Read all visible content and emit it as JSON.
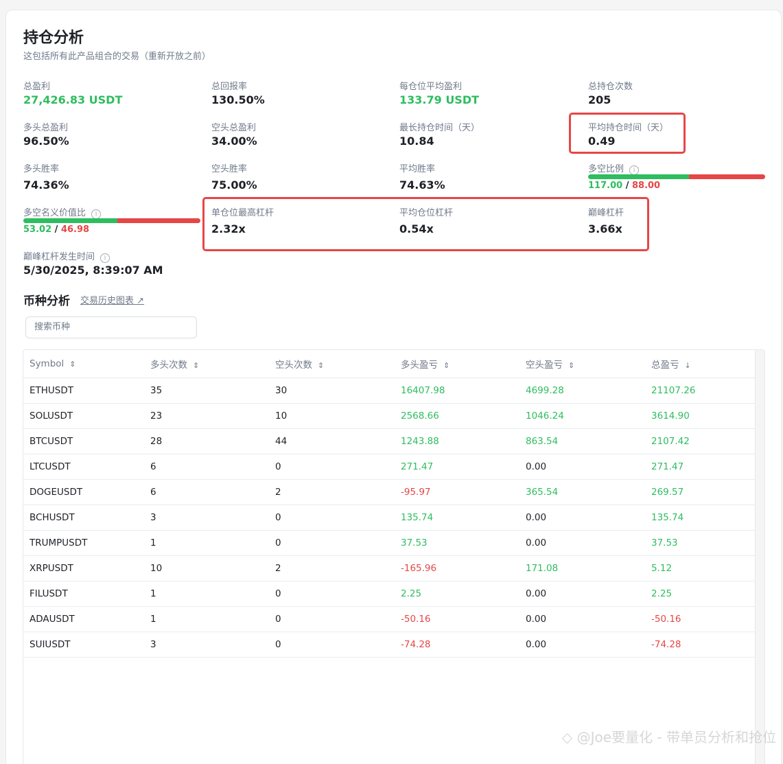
{
  "header": {
    "title": "持仓分析",
    "subtitle": "这包括所有此产品组合的交易（重新开放之前）"
  },
  "stats": {
    "total_pnl": {
      "label": "总盈利",
      "value": "27,426.83 USDT"
    },
    "total_return": {
      "label": "总回报率",
      "value": "130.50%"
    },
    "avg_pnl_per_position": {
      "label": "每仓位平均盈利",
      "value": "133.79 USDT"
    },
    "total_positions": {
      "label": "总持仓次数",
      "value": "205"
    },
    "long_total_pnl": {
      "label": "多头总盈利",
      "value": "96.50%"
    },
    "short_total_pnl": {
      "label": "空头总盈利",
      "value": "34.00%"
    },
    "max_hold_time": {
      "label": "最长持仓时间（天）",
      "value": "10.84"
    },
    "avg_hold_time": {
      "label": "平均持仓时间（天）",
      "value": "0.49"
    },
    "long_win_rate": {
      "label": "多头胜率",
      "value": "74.36%"
    },
    "short_win_rate": {
      "label": "空头胜率",
      "value": "75.00%"
    },
    "avg_win_rate": {
      "label": "平均胜率",
      "value": "74.63%"
    },
    "long_short_ratio": {
      "label": "多空比例",
      "long": "117.00",
      "sep": "/",
      "short": "88.00",
      "long_fraction": 0.5707
    },
    "notional_ratio": {
      "label": "多空名义价值比",
      "long": "53.02",
      "sep": "/",
      "short": "46.98",
      "long_fraction": 0.5302
    },
    "max_leverage_single": {
      "label": "单仓位最高杠杆",
      "value": "2.32x"
    },
    "avg_leverage": {
      "label": "平均仓位杠杆",
      "value": "0.54x"
    },
    "peak_leverage": {
      "label": "巅峰杠杆",
      "value": "3.66x"
    },
    "peak_leverage_time": {
      "label": "巅峰杠杆发生时间",
      "value": "5/30/2025, 8:39:07 AM"
    }
  },
  "coin_analysis": {
    "title": "币种分析",
    "history_link": "交易历史图表 ↗",
    "search_placeholder": "搜索币种",
    "columns": [
      "Symbol",
      "多头次数",
      "空头次数",
      "多头盈亏",
      "空头盈亏",
      "总盈亏"
    ],
    "sort_icons": [
      "⇕",
      "⇕",
      "⇕",
      "⇕",
      "⇕",
      "↓"
    ],
    "rows": [
      [
        "ETHUSDT",
        "35",
        "30",
        "16407.98",
        "4699.28",
        "21107.26"
      ],
      [
        "SOLUSDT",
        "23",
        "10",
        "2568.66",
        "1046.24",
        "3614.90"
      ],
      [
        "BTCUSDT",
        "28",
        "44",
        "1243.88",
        "863.54",
        "2107.42"
      ],
      [
        "LTCUSDT",
        "6",
        "0",
        "271.47",
        "0.00",
        "271.47"
      ],
      [
        "DOGEUSDT",
        "6",
        "2",
        "-95.97",
        "365.54",
        "269.57"
      ],
      [
        "BCHUSDT",
        "3",
        "0",
        "135.74",
        "0.00",
        "135.74"
      ],
      [
        "TRUMPUSDT",
        "1",
        "0",
        "37.53",
        "0.00",
        "37.53"
      ],
      [
        "XRPUSDT",
        "10",
        "2",
        "-165.96",
        "171.08",
        "5.12"
      ],
      [
        "FILUSDT",
        "1",
        "0",
        "2.25",
        "0.00",
        "2.25"
      ],
      [
        "ADAUSDT",
        "1",
        "0",
        "-50.16",
        "0.00",
        "-50.16"
      ],
      [
        "SUIUSDT",
        "3",
        "0",
        "-74.28",
        "0.00",
        "-74.28"
      ]
    ]
  },
  "watermark": "◇ @Joe要量化 - 带单员分析和抢位",
  "colors": {
    "positive": "#2ebd5f",
    "negative": "#e64646",
    "highlight_box": "#e64646"
  }
}
